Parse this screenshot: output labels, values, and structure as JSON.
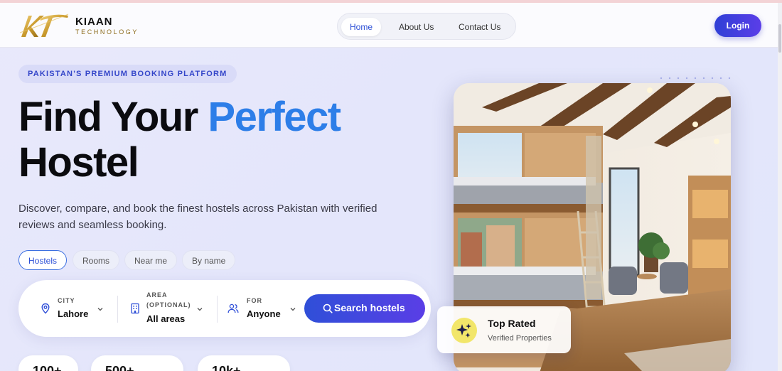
{
  "brand": {
    "logo_letters": "KT",
    "name": "KIAAN",
    "subtitle": "TECHNOLOGY",
    "colors": {
      "gold": "#c99a2e",
      "accent_blue": "#2d7ee8",
      "primary": "#3b46dc"
    }
  },
  "nav": {
    "links": [
      {
        "label": "Home",
        "active": true
      },
      {
        "label": "About Us",
        "active": false
      },
      {
        "label": "Contact Us",
        "active": false
      }
    ],
    "login_label": "Login"
  },
  "hero": {
    "badge": "PAKISTAN'S PREMIUM BOOKING PLATFORM",
    "title_part1": "Find Your",
    "title_accent": "Perfect",
    "title_line2": "Hostel",
    "description": "Discover, compare, and book the finest hostels across Pakistan with verified reviews and seamless booking."
  },
  "search_tabs": [
    {
      "label": "Hostels",
      "active": true
    },
    {
      "label": "Rooms",
      "active": false
    },
    {
      "label": "Near me",
      "active": false
    },
    {
      "label": "By name",
      "active": false
    }
  ],
  "search": {
    "city": {
      "label": "CITY",
      "value": "Lahore",
      "icon": "location-pin-icon"
    },
    "area": {
      "label_line1": "AREA",
      "label_line2": "(OPTIONAL)",
      "value": "All areas",
      "icon": "building-icon"
    },
    "for": {
      "label": "FOR",
      "value": "Anyone",
      "icon": "users-icon"
    },
    "button_label": "Search hostels"
  },
  "stats": [
    {
      "value": "100+"
    },
    {
      "value": "500+"
    },
    {
      "value": "10k+"
    }
  ],
  "highlight_card": {
    "title": "Top Rated",
    "subtitle": "Verified Properties",
    "icon": "sparkle-icon"
  }
}
